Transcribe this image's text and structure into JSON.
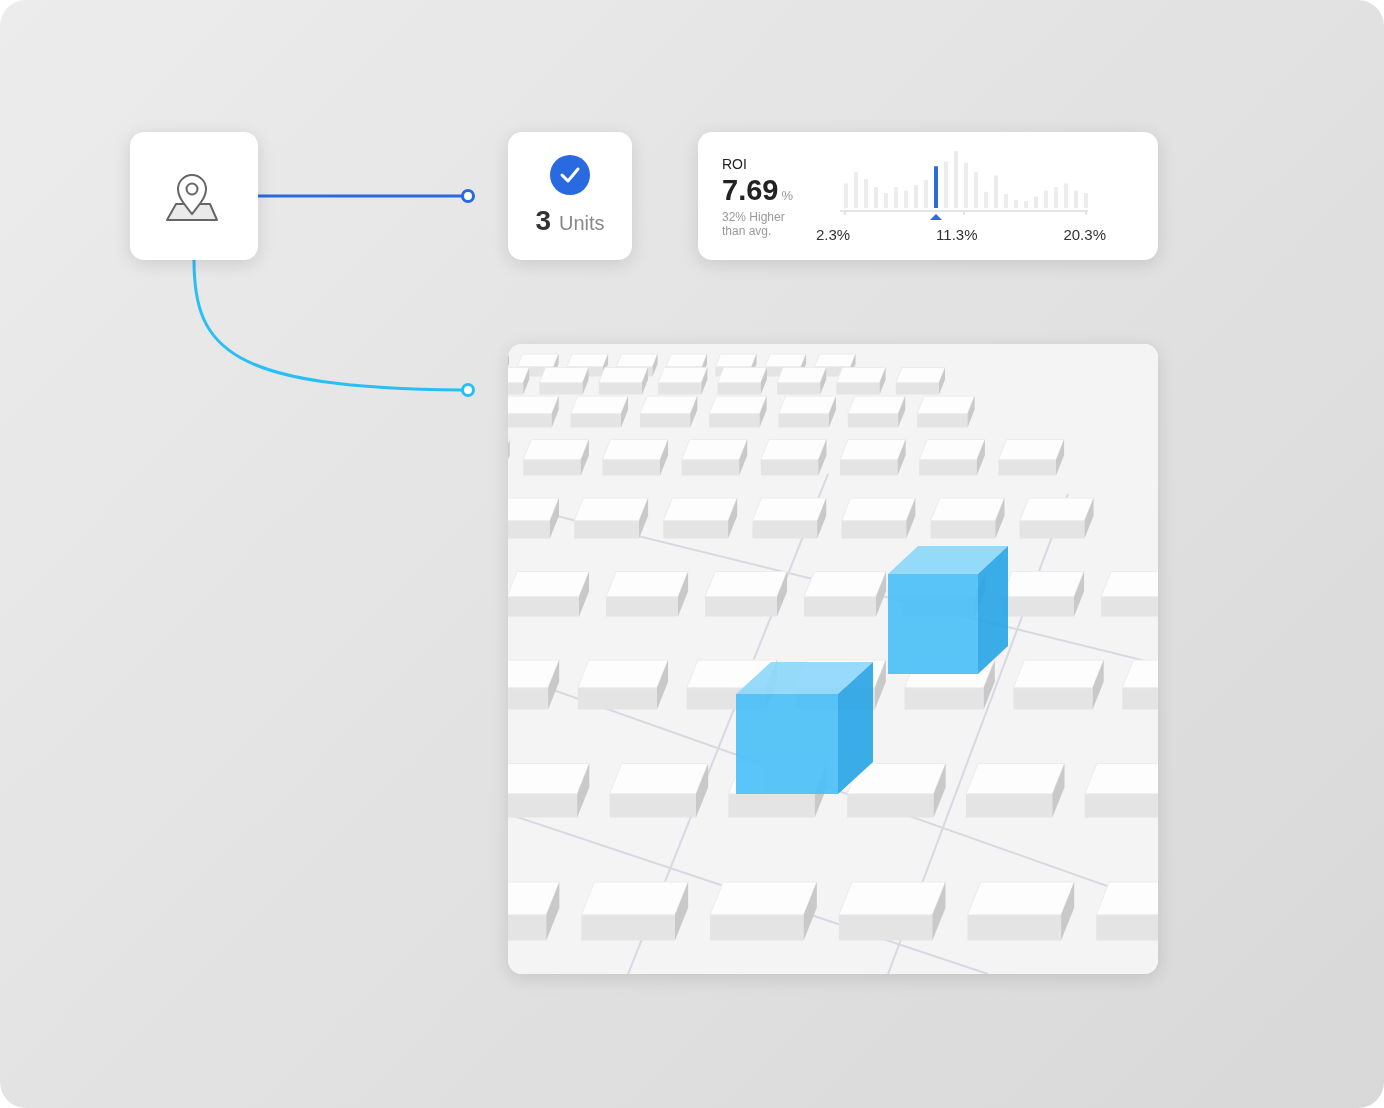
{
  "units_card": {
    "count": "3",
    "label": "Units"
  },
  "roi_card": {
    "title": "ROI",
    "value": "7.69",
    "unit": "%",
    "note": "32% Higher than avg.",
    "axis_labels": [
      "2.3%",
      "11.3%",
      "20.3%"
    ]
  }
}
